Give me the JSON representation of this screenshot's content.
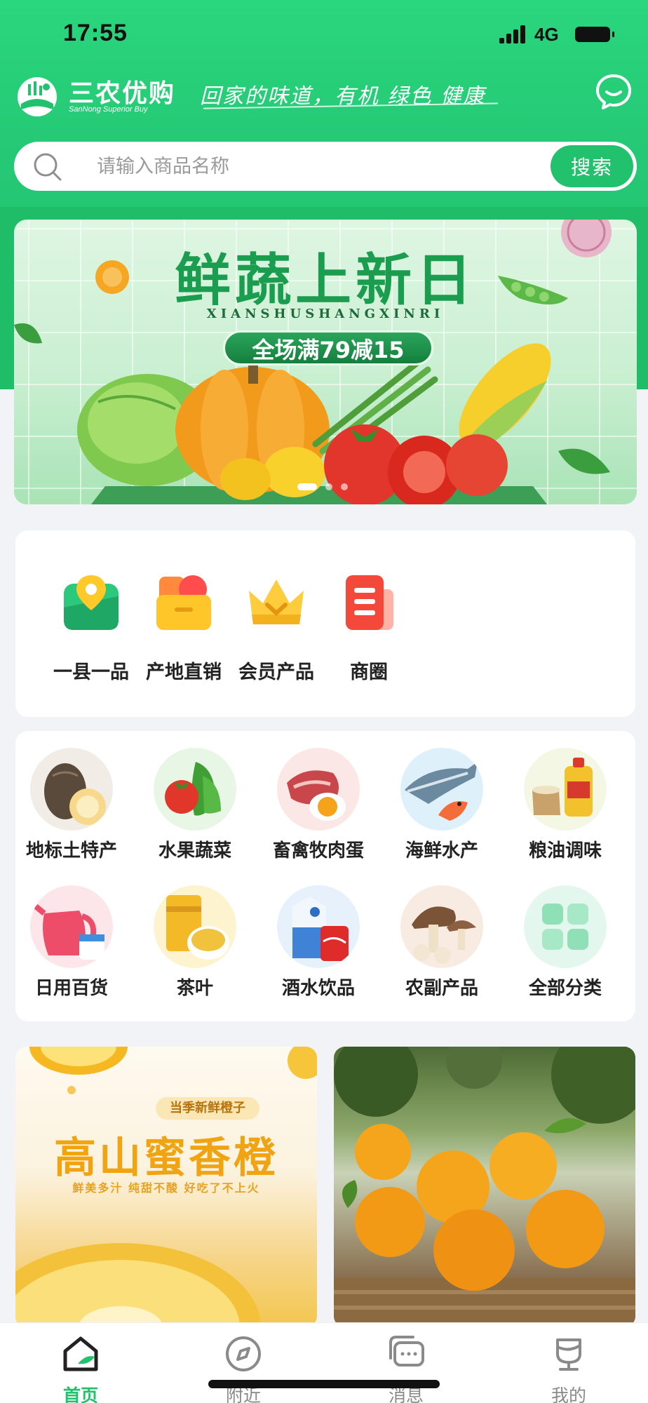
{
  "status_bar": {
    "time": "17:55",
    "network": "4G"
  },
  "header": {
    "brand_name": "三农优购",
    "brand_subtitle": "SanNong Superior Buy",
    "slogan": "回家的味道，有机 绿色 健康"
  },
  "search": {
    "placeholder": "请输入商品名称",
    "button_label": "搜索"
  },
  "banner": {
    "title": "鲜蔬上新日",
    "subtitle": "XIANSHUSHANGXINRI",
    "promo": "全场满79减15",
    "dots": 3,
    "active_dot": 0
  },
  "quick_entries": [
    {
      "label": "一县一品",
      "icon": "map-pin-icon"
    },
    {
      "label": "产地直销",
      "icon": "basket-icon"
    },
    {
      "label": "会员产品",
      "icon": "crown-icon"
    },
    {
      "label": "商圈",
      "icon": "document-icon"
    }
  ],
  "categories": [
    {
      "label": "地标土特产",
      "icon": "taro-icon"
    },
    {
      "label": "水果蔬菜",
      "icon": "vegetables-icon"
    },
    {
      "label": "畜禽牧肉蛋",
      "icon": "meat-egg-icon"
    },
    {
      "label": "海鲜水产",
      "icon": "seafood-icon"
    },
    {
      "label": "粮油调味",
      "icon": "grain-oil-icon"
    },
    {
      "label": "日用百货",
      "icon": "kettle-icon"
    },
    {
      "label": "茶叶",
      "icon": "tea-icon"
    },
    {
      "label": "酒水饮品",
      "icon": "drinks-icon"
    },
    {
      "label": "农副产品",
      "icon": "mushroom-icon"
    },
    {
      "label": "全部分类",
      "icon": "all-categories-icon"
    }
  ],
  "promo_tiles": {
    "left": {
      "tag": "当季新鲜橙子",
      "title": "高山蜜香橙",
      "desc": "鲜美多汁  纯甜不酸  好吃了不上火"
    }
  },
  "tabbar": [
    {
      "label": "首页",
      "icon": "home-icon",
      "active": true
    },
    {
      "label": "附近",
      "icon": "compass-icon",
      "active": false
    },
    {
      "label": "消息",
      "icon": "chat-icon",
      "active": false
    },
    {
      "label": "我的",
      "icon": "profile-icon",
      "active": false
    }
  ],
  "colors": {
    "accent": "#22c16d",
    "header": "#25c874"
  }
}
